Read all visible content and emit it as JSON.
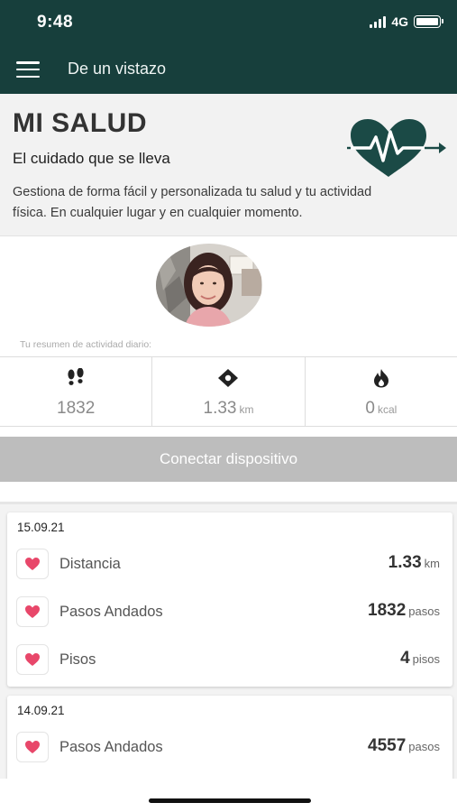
{
  "status_bar": {
    "time": "9:48",
    "network": "4G"
  },
  "app_bar": {
    "title": "De un vistazo",
    "menu_icon": "hamburger-menu-icon"
  },
  "hero": {
    "title": "MI SALUD",
    "subtitle": "El cuidado que se lleva",
    "description": "Gestiona de forma fácil y personalizada tu salud y tu actividad física. En cualquier lugar y en cualquier momento.",
    "icon": "heart-pulse-icon",
    "accent_color": "#1b4a46"
  },
  "profile": {
    "summary_label": "Tu resumen de actividad diario:"
  },
  "stats": [
    {
      "icon": "footsteps-icon",
      "value": "1832",
      "unit": ""
    },
    {
      "icon": "location-diamond-icon",
      "value": "1.33",
      "unit": "km"
    },
    {
      "icon": "flame-icon",
      "value": "0",
      "unit": "kcal"
    }
  ],
  "connect_button": {
    "label": "Conectar dispositivo"
  },
  "cards": [
    {
      "date": "15.09.21",
      "rows": [
        {
          "label": "Distancia",
          "value": "1.33",
          "unit": "km"
        },
        {
          "label": "Pasos Andados",
          "value": "1832",
          "unit": "pasos"
        },
        {
          "label": "Pisos",
          "value": "4",
          "unit": "pisos"
        }
      ]
    },
    {
      "date": "14.09.21",
      "rows": [
        {
          "label": "Pasos Andados",
          "value": "4557",
          "unit": "pasos"
        }
      ]
    }
  ],
  "colors": {
    "topbar": "#173f3c",
    "heart": "#e8476a",
    "button_disabled": "#bdbdbd"
  }
}
